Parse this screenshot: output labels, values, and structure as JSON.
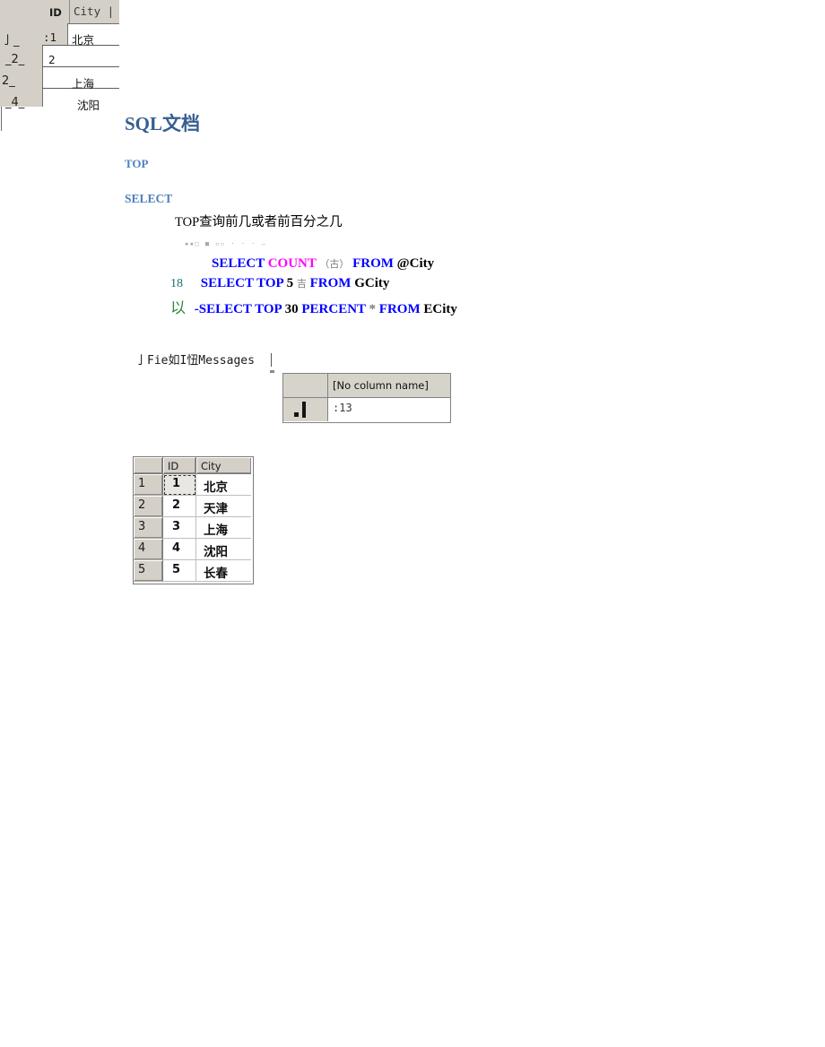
{
  "document": {
    "title": "SQL文档",
    "heading_top": "TOP",
    "heading_select": "SELECT",
    "paragraph": "TOP查询前几或者前百分之几"
  },
  "code_block": {
    "noise_line": "▪▪□ ■ ▫▫ · · · –",
    "lines": [
      {
        "gutter": "",
        "tokens": [
          {
            "text": "SELECT",
            "kind": "keyword"
          },
          {
            "text": "COUNT",
            "kind": "function"
          },
          {
            "text": "（古）",
            "kind": "dim"
          },
          {
            "text": "FROM",
            "kind": "keyword"
          },
          {
            "text": "@City",
            "kind": "identifier"
          }
        ]
      },
      {
        "gutter": "18",
        "tokens": [
          {
            "text": "SELECT TOP",
            "kind": "keyword"
          },
          {
            "text": "5",
            "kind": "number"
          },
          {
            "text": "吉",
            "kind": "dim"
          },
          {
            "text": "FROM",
            "kind": "keyword"
          },
          {
            "text": "GCity",
            "kind": "identifier"
          }
        ]
      },
      {
        "gutter": "以",
        "tokens": [
          {
            "text": "-SELECT TOP",
            "kind": "keyword"
          },
          {
            "text": "30",
            "kind": "number"
          },
          {
            "text": "PERCENT",
            "kind": "keyword"
          },
          {
            "text": "*",
            "kind": "star"
          },
          {
            "text": "FROM",
            "kind": "keyword"
          },
          {
            "text": "ECity",
            "kind": "identifier"
          }
        ]
      }
    ],
    "colors": {
      "keyword": "#0000ff",
      "function": "#ff00ff",
      "identifier": "#000000",
      "dim": "#7a7a7a",
      "gutter_number": "#1f6f6f",
      "gutter_glyph": "#2e8b3d"
    }
  },
  "tabstrip": {
    "label": "亅Fie如I忸Messages"
  },
  "result_grid": {
    "column_header": "[No column name]",
    "value": ":13"
  },
  "grid_one": {
    "headers": [
      "",
      "ID",
      "City"
    ],
    "rows": [
      {
        "marker": "1",
        "id": "1",
        "city": "北京",
        "selected": true
      },
      {
        "marker": "2",
        "id": "2",
        "city": "天津",
        "selected": false
      },
      {
        "marker": "3",
        "id": "3",
        "city": "上海",
        "selected": false
      },
      {
        "marker": "4",
        "id": "4",
        "city": "沈阳",
        "selected": false
      },
      {
        "marker": "5",
        "id": "5",
        "city": "长春",
        "selected": false
      }
    ]
  },
  "grid_two": {
    "headers": {
      "id": "ID",
      "city": "City  |"
    },
    "rows": [
      {
        "marker": "亅_",
        "id": ":1",
        "city": "北京"
      },
      {
        "marker": "_2_",
        "id": "2",
        "city": ""
      },
      {
        "marker": "2_",
        "id": "",
        "city": "上海"
      },
      {
        "marker": "_4_",
        "id": "",
        "city": "沈阳"
      }
    ]
  },
  "theme": {
    "heading_color": "#365f91",
    "subheading_color": "#4f81bd",
    "grid_face": "#d4d0c8",
    "grid_border": "#7b7b7b",
    "page_background": "#ffffff"
  }
}
